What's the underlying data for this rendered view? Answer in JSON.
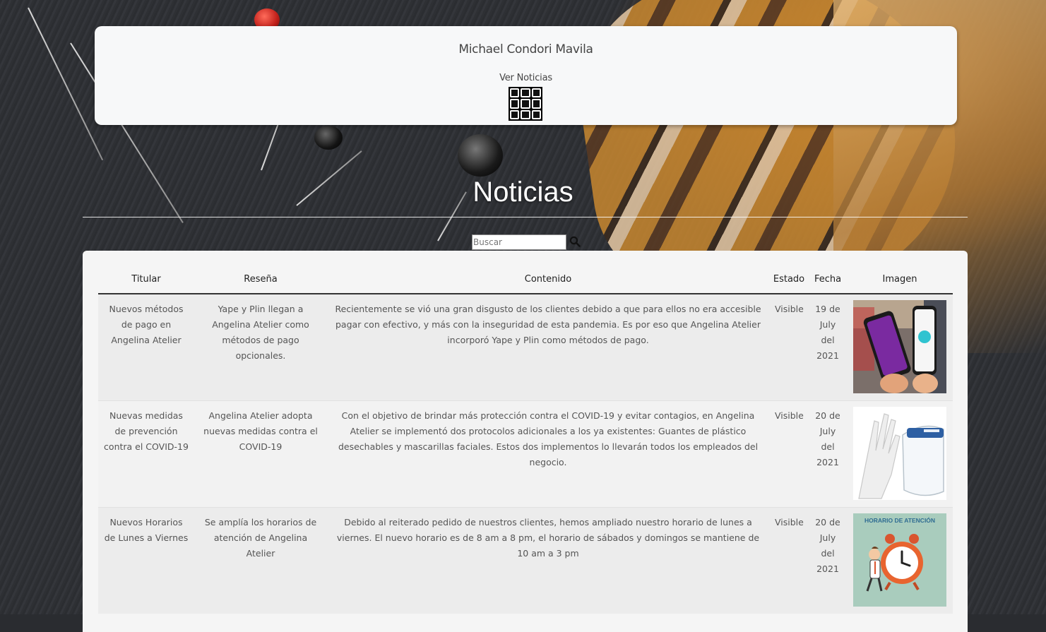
{
  "header": {
    "site_owner": "Michael Condori Mavila",
    "nav_label": "Ver Noticias",
    "nav_icon": "grid-menu-icon"
  },
  "page": {
    "title": "Noticias"
  },
  "search": {
    "placeholder": "Buscar",
    "icon": "search-icon"
  },
  "table": {
    "headers": {
      "titular": "Titular",
      "resena": "Reseña",
      "contenido": "Contenido",
      "estado": "Estado",
      "fecha": "Fecha",
      "imagen": "Imagen"
    },
    "rows": [
      {
        "titular": "Nuevos métodos de pago en Angelina Atelier",
        "resena": "Yape y Plin llegan a Angelina Atelier como métodos de pago opcionales.",
        "contenido": "Recientemente se vió una gran disgusto de los clientes debido a que para ellos no era accesible pagar con efectivo, y más con la inseguridad de esta pandemia. Es por eso que Angelina Atelier incorporó Yape y Plin como métodos de pago.",
        "estado": "Visible",
        "fecha": "19 de July del 2021",
        "imagen": "phones-yape-plin"
      },
      {
        "titular": "Nuevas medidas de prevención contra el COVID-19",
        "resena": "Angelina Atelier adopta nuevas medidas contra el COVID-19",
        "contenido": "Con el objetivo de brindar más protección contra el COVID-19 y evitar contagios, en Angelina Atelier se implementó dos protocolos adicionales a los ya existentes: Guantes de plástico desechables y mascarillas faciales. Estos dos implementos lo llevarán todos los empleados del negocio.",
        "estado": "Visible",
        "fecha": "20 de July del 2021",
        "imagen": "gloves-face-shield"
      },
      {
        "titular": "Nuevos Horarios de Lunes a Viernes",
        "resena": "Se amplía los horarios de atención de Angelina Atelier",
        "contenido": "Debido al reiterado pedido de nuestros clientes, hemos ampliado nuestro horario de lunes a viernes. El nuevo horario es de 8 am a 8 pm, el horario de sábados y domingos se mantiene de 10 am a 3 pm",
        "estado": "Visible",
        "fecha": "20 de July del 2021",
        "imagen": "alarm-clock-schedule",
        "imagen_text": "HORARIO DE ATENCIÓN"
      }
    ]
  },
  "colors": {
    "header_bg": "#f7f8f9",
    "panel_bg": "#f5f5f5",
    "row_odd": "#ececec",
    "row_even": "#f2f2f2",
    "title_text": "#ffffff"
  }
}
